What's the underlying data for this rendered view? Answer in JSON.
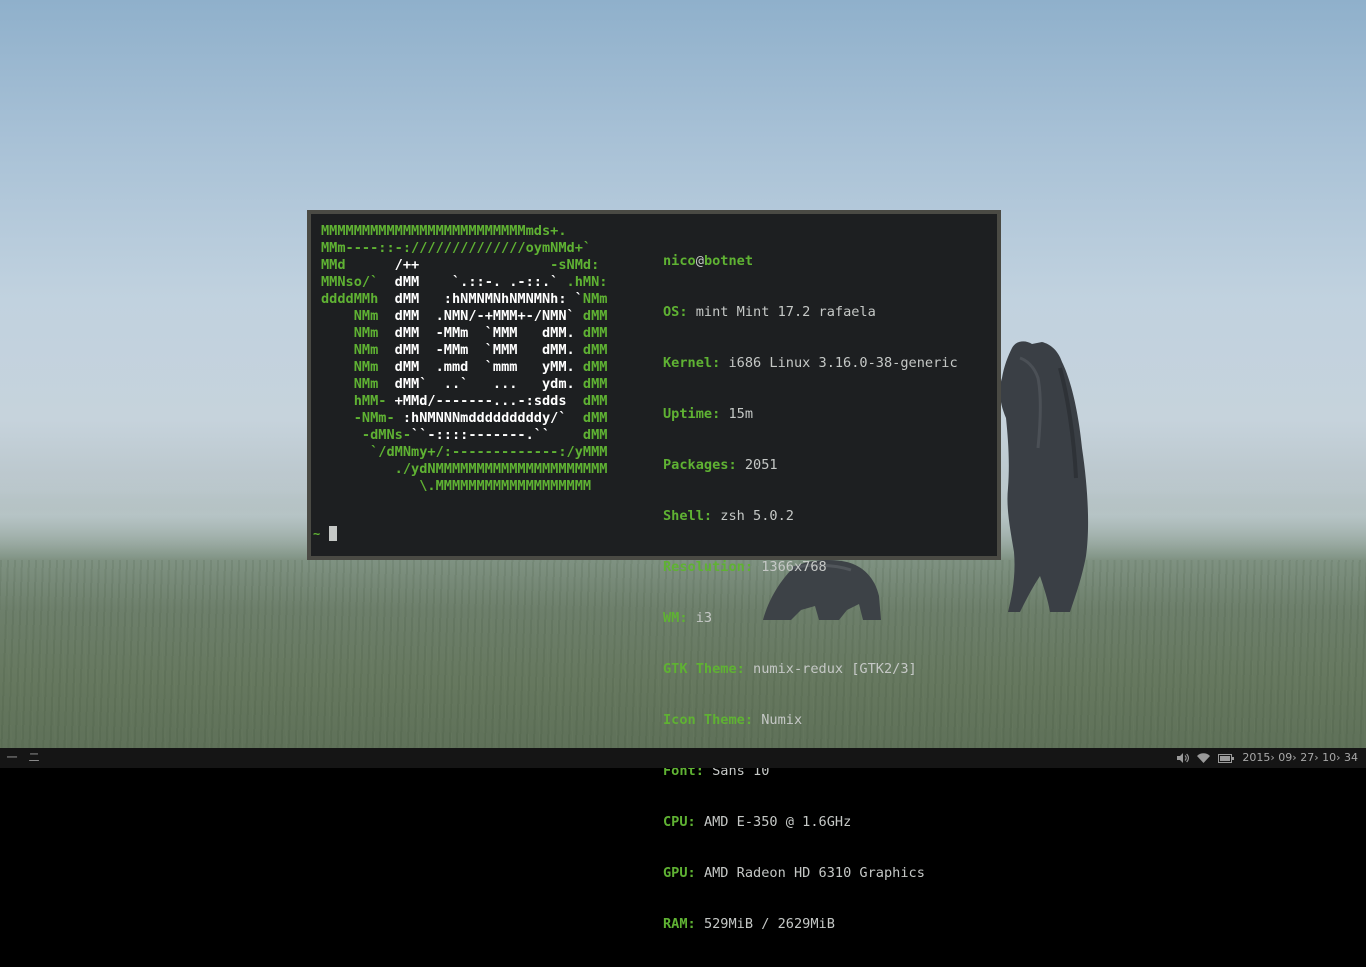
{
  "desktop": {
    "wallpaper": "misty meadow with two standing bears",
    "colors": {
      "sky": "#b4c8d9",
      "grass": "#66785f"
    }
  },
  "terminal": {
    "colors": {
      "background": "#1d1f21",
      "border": "#4a4a44",
      "accent": "#5fb233",
      "text": "#c5c8c6"
    },
    "logo_lines": [
      "MMMMMMMMMMMMMMMMMMMMMMMMMmds+.",
      "MMm----::-://////////////oymNMd+`",
      "MMd      /++                -sNMd:",
      "MMNso/`  dMM    `.::-. .-::.` .hMN:",
      "ddddMMh  dMM   :hNMNMNhNMNMNh: `NMm",
      "    NMm  dMM  .NMN/-+MMM+-/NMN` dMM",
      "    NMm  dMM  -MMm  `MMM   dMM. dMM",
      "    NMm  dMM  -MMm  `MMM   dMM. dMM",
      "    NMm  dMM  .mmd  `mmm   yMM. dMM",
      "    NMm  dMM`  ..`   ...   ydm. dMM",
      "    hMM- +MMd/-------...-:sdds  dMM",
      "    -NMm- :hNMNNNmdddddddddy/`  dMM",
      "     -dMNs-``-::::-------.``    dMM",
      "      `/dMNmy+/:-------------:/yMMM",
      "         ./ydNMMMMMMMMMMMMMMMMMMMMM",
      "            \\.MMMMMMMMMMMMMMMMMMM"
    ],
    "user": "nico",
    "at": "@",
    "host": "botnet",
    "info": [
      {
        "key": "OS:",
        "value": "mint Mint 17.2 rafaela"
      },
      {
        "key": "Kernel:",
        "value": "i686 Linux 3.16.0-38-generic"
      },
      {
        "key": "Uptime:",
        "value": "15m"
      },
      {
        "key": "Packages:",
        "value": "2051"
      },
      {
        "key": "Shell:",
        "value": "zsh 5.0.2"
      },
      {
        "key": "Resolution:",
        "value": "1366x768"
      },
      {
        "key": "WM:",
        "value": "i3"
      },
      {
        "key": "GTK Theme:",
        "value": "numix-redux [GTK2/3]"
      },
      {
        "key": "Icon Theme:",
        "value": "Numix"
      },
      {
        "key": "Font:",
        "value": "Sans 10"
      },
      {
        "key": "CPU:",
        "value": "AMD E-350 @ 1.6GHz"
      },
      {
        "key": "GPU:",
        "value": "AMD Radeon HD 6310 Graphics"
      },
      {
        "key": "RAM:",
        "value": "529MiB / 2629MiB"
      }
    ],
    "prompt": {
      "dir": "~"
    }
  },
  "bar": {
    "colors": {
      "background": "#151515",
      "text": "#9a9a9a"
    },
    "workspaces": [
      {
        "label": "一",
        "active": false
      },
      {
        "label": "二",
        "active": false
      }
    ],
    "tray_icons": [
      "volume-icon",
      "wifi-icon",
      "battery-icon"
    ],
    "clock": "2015› 09› 27› 10› 34"
  }
}
